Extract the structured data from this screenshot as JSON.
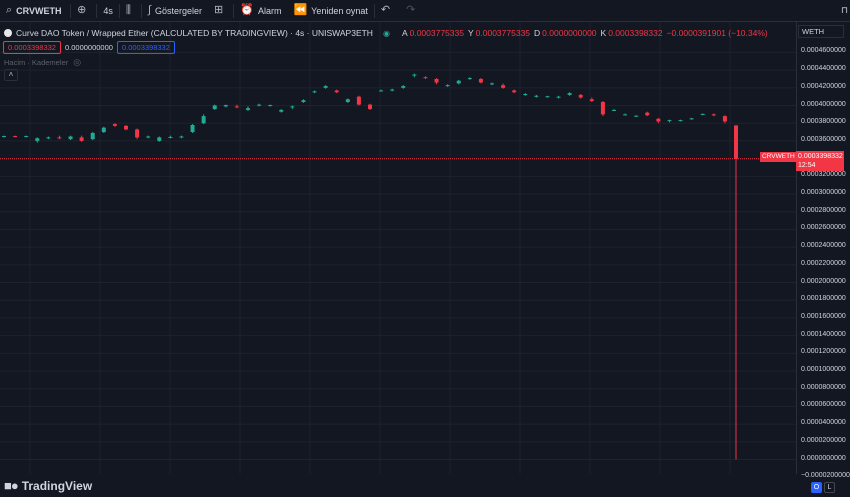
{
  "toolbar": {
    "symbol": "CRVWETH",
    "interval": "4s",
    "indicators_label": "Göstergeler",
    "alert_label": "Alarm",
    "replay_label": "Yeniden oynat"
  },
  "legend": {
    "title": "Curve DAO Token / Wrapped Ether (CALCULATED BY TRADINGVIEW) · 4s · UNISWAP3ETH",
    "open_label": "A",
    "open": "0.0003775335",
    "high_label": "Y",
    "high": "0.0003775335",
    "low_label": "D",
    "low": "0.0000000000",
    "close_label": "K",
    "close": "0.0003398332",
    "change": "−0.0000391901 (−10.34%)"
  },
  "price_boxes": {
    "sell": "0.0003398332",
    "spread": "0.0000000000",
    "buy": "0.0003398332"
  },
  "volume_label": "Hacim · Kademeler",
  "price_scale": {
    "currency": "WETH",
    "ticks": [
      "0.0004600000",
      "0.0004400000",
      "0.0004200000",
      "0.0004000000",
      "0.0003800000",
      "0.0003600000",
      "0.0003200000",
      "0.0003000000",
      "0.0002800000",
      "0.0002600000",
      "0.0002400000",
      "0.0002200000",
      "0.0002000000",
      "0.0001800000",
      "0.0001600000",
      "0.0001400000",
      "0.0001200000",
      "0.0001000000",
      "0.0000800000",
      "0.0000600000",
      "0.0000400000",
      "0.0000200000",
      "0.0000000000",
      "−0.0000200000"
    ],
    "current_symbol": "CRVWETH",
    "current_price": "0.0003398332",
    "countdown": "12:54"
  },
  "branding": "TradingView",
  "bottom_buttons": {
    "log": "O",
    "auto": "L"
  },
  "colors": {
    "up": "#22ab94",
    "down": "#f23645",
    "bg": "#131722",
    "grid": "#1e222d",
    "accent": "#2962ff"
  },
  "chart_data": {
    "type": "candlestick",
    "ylim": [
      -2e-05,
      0.000465
    ],
    "candles": [
      {
        "o": 0.000365,
        "h": 0.000366,
        "l": 0.000364,
        "c": 0.0003655
      },
      {
        "o": 0.0003655,
        "h": 0.000366,
        "l": 0.000364,
        "c": 0.000365
      },
      {
        "o": 0.000365,
        "h": 0.000366,
        "l": 0.000364,
        "c": 0.0003655
      },
      {
        "o": 0.00036,
        "h": 0.000364,
        "l": 0.000358,
        "c": 0.000363
      },
      {
        "o": 0.000363,
        "h": 0.000365,
        "l": 0.000362,
        "c": 0.000364
      },
      {
        "o": 0.000364,
        "h": 0.000366,
        "l": 0.000362,
        "c": 0.0003635
      },
      {
        "o": 0.000362,
        "h": 0.000366,
        "l": 0.000361,
        "c": 0.000365
      },
      {
        "o": 0.000364,
        "h": 0.000366,
        "l": 0.000359,
        "c": 0.00036
      },
      {
        "o": 0.000362,
        "h": 0.00037,
        "l": 0.000361,
        "c": 0.000369
      },
      {
        "o": 0.00037,
        "h": 0.000376,
        "l": 0.000369,
        "c": 0.000375
      },
      {
        "o": 0.000379,
        "h": 0.00038,
        "l": 0.000376,
        "c": 0.000377
      },
      {
        "o": 0.000377,
        "h": 0.000378,
        "l": 0.000372,
        "c": 0.000373
      },
      {
        "o": 0.000373,
        "h": 0.000374,
        "l": 0.000362,
        "c": 0.000364
      },
      {
        "o": 0.000364,
        "h": 0.000366,
        "l": 0.000363,
        "c": 0.000365
      },
      {
        "o": 0.00036,
        "h": 0.000365,
        "l": 0.000359,
        "c": 0.000364
      },
      {
        "o": 0.000364,
        "h": 0.000366,
        "l": 0.000363,
        "c": 0.0003645
      },
      {
        "o": 0.000364,
        "h": 0.000366,
        "l": 0.000363,
        "c": 0.000365
      },
      {
        "o": 0.00037,
        "h": 0.000379,
        "l": 0.000369,
        "c": 0.000378
      },
      {
        "o": 0.00038,
        "h": 0.00039,
        "l": 0.000379,
        "c": 0.000388
      },
      {
        "o": 0.000396,
        "h": 0.000401,
        "l": 0.000395,
        "c": 0.0004
      },
      {
        "o": 0.000399,
        "h": 0.000401,
        "l": 0.000398,
        "c": 0.0004005
      },
      {
        "o": 0.000399,
        "h": 0.000401,
        "l": 0.000397,
        "c": 0.000398
      },
      {
        "o": 0.000395,
        "h": 0.000399,
        "l": 0.000394,
        "c": 0.000397
      },
      {
        "o": 0.0004,
        "h": 0.000402,
        "l": 0.000399,
        "c": 0.000401
      },
      {
        "o": 0.0004,
        "h": 0.000401,
        "l": 0.000399,
        "c": 0.0004005
      },
      {
        "o": 0.000393,
        "h": 0.000396,
        "l": 0.000392,
        "c": 0.000395
      },
      {
        "o": 0.000398,
        "h": 0.0004,
        "l": 0.000396,
        "c": 0.000399
      },
      {
        "o": 0.000404,
        "h": 0.000407,
        "l": 0.000403,
        "c": 0.000406
      },
      {
        "o": 0.000415,
        "h": 0.000417,
        "l": 0.000414,
        "c": 0.000416
      },
      {
        "o": 0.00042,
        "h": 0.000423,
        "l": 0.000419,
        "c": 0.000422
      },
      {
        "o": 0.000417,
        "h": 0.000418,
        "l": 0.000414,
        "c": 0.000415
      },
      {
        "o": 0.000404,
        "h": 0.000408,
        "l": 0.000403,
        "c": 0.000407
      },
      {
        "o": 0.00041,
        "h": 0.000411,
        "l": 0.0004,
        "c": 0.000401
      },
      {
        "o": 0.000401,
        "h": 0.000402,
        "l": 0.000395,
        "c": 0.000396
      },
      {
        "o": 0.000417,
        "h": 0.000418,
        "l": 0.000416,
        "c": 0.000417
      },
      {
        "o": 0.000417,
        "h": 0.000419,
        "l": 0.000416,
        "c": 0.000418
      },
      {
        "o": 0.00042,
        "h": 0.000423,
        "l": 0.000419,
        "c": 0.000422
      },
      {
        "o": 0.000434,
        "h": 0.000436,
        "l": 0.000432,
        "c": 0.000435
      },
      {
        "o": 0.000432,
        "h": 0.000433,
        "l": 0.00043,
        "c": 0.000431
      },
      {
        "o": 0.00043,
        "h": 0.000431,
        "l": 0.000424,
        "c": 0.000426
      },
      {
        "o": 0.000422,
        "h": 0.000424,
        "l": 0.000421,
        "c": 0.000423
      },
      {
        "o": 0.000425,
        "h": 0.000429,
        "l": 0.000424,
        "c": 0.000428
      },
      {
        "o": 0.00043,
        "h": 0.000432,
        "l": 0.000429,
        "c": 0.000431
      },
      {
        "o": 0.00043,
        "h": 0.000431,
        "l": 0.000425,
        "c": 0.000426
      },
      {
        "o": 0.000424,
        "h": 0.000426,
        "l": 0.000423,
        "c": 0.000425
      },
      {
        "o": 0.000423,
        "h": 0.000425,
        "l": 0.000419,
        "c": 0.00042
      },
      {
        "o": 0.000417,
        "h": 0.000418,
        "l": 0.000414,
        "c": 0.000415
      },
      {
        "o": 0.000412,
        "h": 0.000414,
        "l": 0.000411,
        "c": 0.000413
      },
      {
        "o": 0.00041,
        "h": 0.000412,
        "l": 0.000409,
        "c": 0.000411
      },
      {
        "o": 0.00041,
        "h": 0.000411,
        "l": 0.000409,
        "c": 0.0004105
      },
      {
        "o": 0.000409,
        "h": 0.000411,
        "l": 0.000408,
        "c": 0.00041
      },
      {
        "o": 0.000412,
        "h": 0.000415,
        "l": 0.000411,
        "c": 0.000414
      },
      {
        "o": 0.000412,
        "h": 0.000413,
        "l": 0.000408,
        "c": 0.000409
      },
      {
        "o": 0.000407,
        "h": 0.000409,
        "l": 0.000404,
        "c": 0.000405
      },
      {
        "o": 0.000404,
        "h": 0.000405,
        "l": 0.000388,
        "c": 0.00039
      },
      {
        "o": 0.000395,
        "h": 0.000396,
        "l": 0.000394,
        "c": 0.000395
      },
      {
        "o": 0.00039,
        "h": 0.000391,
        "l": 0.000389,
        "c": 0.00039
      },
      {
        "o": 0.000388,
        "h": 0.000389,
        "l": 0.000387,
        "c": 0.0003885
      },
      {
        "o": 0.000392,
        "h": 0.000393,
        "l": 0.000388,
        "c": 0.000389
      },
      {
        "o": 0.000385,
        "h": 0.000386,
        "l": 0.00038,
        "c": 0.000382
      },
      {
        "o": 0.000383,
        "h": 0.000384,
        "l": 0.000381,
        "c": 0.0003835
      },
      {
        "o": 0.000383,
        "h": 0.000384,
        "l": 0.000382,
        "c": 0.0003835
      },
      {
        "o": 0.000385,
        "h": 0.000386,
        "l": 0.000384,
        "c": 0.0003855
      },
      {
        "o": 0.00039,
        "h": 0.000391,
        "l": 0.000389,
        "c": 0.0003905
      },
      {
        "o": 0.00039,
        "h": 0.000391,
        "l": 0.000388,
        "c": 0.000389
      },
      {
        "o": 0.000388,
        "h": 0.000389,
        "l": 0.00038,
        "c": 0.000382
      },
      {
        "o": 0.0003775335,
        "h": 0.0003775335,
        "l": 0.0,
        "c": 0.0003398332
      }
    ]
  }
}
